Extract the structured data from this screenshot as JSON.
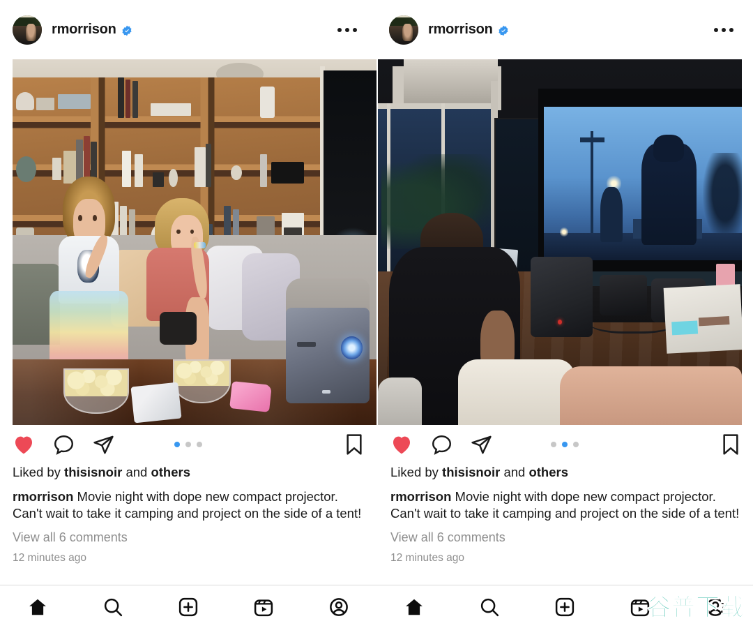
{
  "app": {
    "name": "instagram-feed"
  },
  "posts": [
    {
      "id": "post-left",
      "header": {
        "username": "rmorrison",
        "verified_icon": "verified-badge-icon",
        "avatar_icon": "user-avatar",
        "more_icon": "more-options-icon"
      },
      "media": {
        "alt": "Two children sitting on a couch in a living room with popcorn bowls and a compact projector on a wooden table",
        "carousel": {
          "total": 3,
          "active_index": 0
        }
      },
      "actions": {
        "like_icon": "heart-filled-icon",
        "like_state": "liked",
        "comment_icon": "comment-bubble-icon",
        "share_icon": "share-paper-plane-icon",
        "save_icon": "bookmark-icon"
      },
      "likes_prefix": "Liked by ",
      "likes_user": "thisisnoir",
      "likes_middle": " and ",
      "likes_suffix": "others",
      "caption_author": "rmorrison",
      "caption_text": " Movie night with dope new compact projector.  Can't wait to take it camping and project on the side of a tent!",
      "view_comments": "View all 6 comments",
      "timestamp": "12 minutes ago"
    },
    {
      "id": "post-right",
      "header": {
        "username": "rmorrison",
        "verified_icon": "verified-badge-icon",
        "avatar_icon": "user-avatar",
        "more_icon": "more-options-icon"
      },
      "media": {
        "alt": "Dark living room at night, a woman watching a movie on a large projection screen with cameras and a projector on the table",
        "carousel": {
          "total": 3,
          "active_index": 1
        }
      },
      "actions": {
        "like_icon": "heart-filled-icon",
        "like_state": "liked",
        "comment_icon": "comment-bubble-icon",
        "share_icon": "share-paper-plane-icon",
        "save_icon": "bookmark-icon"
      },
      "likes_prefix": "Liked by ",
      "likes_user": "thisisnoir",
      "likes_middle": " and ",
      "likes_suffix": "others",
      "caption_author": "rmorrison",
      "caption_text": " Movie night with dope new compact projector.  Can't wait to take it camping and project on the side of a tent!",
      "view_comments": "View all 6 comments",
      "timestamp": "12 minutes ago"
    }
  ],
  "bottom_nav": {
    "items": [
      {
        "icon": "home-icon",
        "state": "active"
      },
      {
        "icon": "search-icon",
        "state": "inactive"
      },
      {
        "icon": "new-post-plus-icon",
        "state": "inactive"
      },
      {
        "icon": "reels-icon",
        "state": "inactive"
      },
      {
        "icon": "profile-icon",
        "state": "inactive"
      }
    ]
  },
  "watermark": {
    "text": "谷普下载",
    "color": "#2fb9a4"
  },
  "colors": {
    "like_red": "#ed4956",
    "verified_blue": "#3897f0",
    "dot_active": "#3897f0",
    "dot_inactive": "#c7c7c7",
    "muted_text": "#8e8e8e",
    "primary_text": "#1a1a1a",
    "divider": "#dbdbdb"
  }
}
